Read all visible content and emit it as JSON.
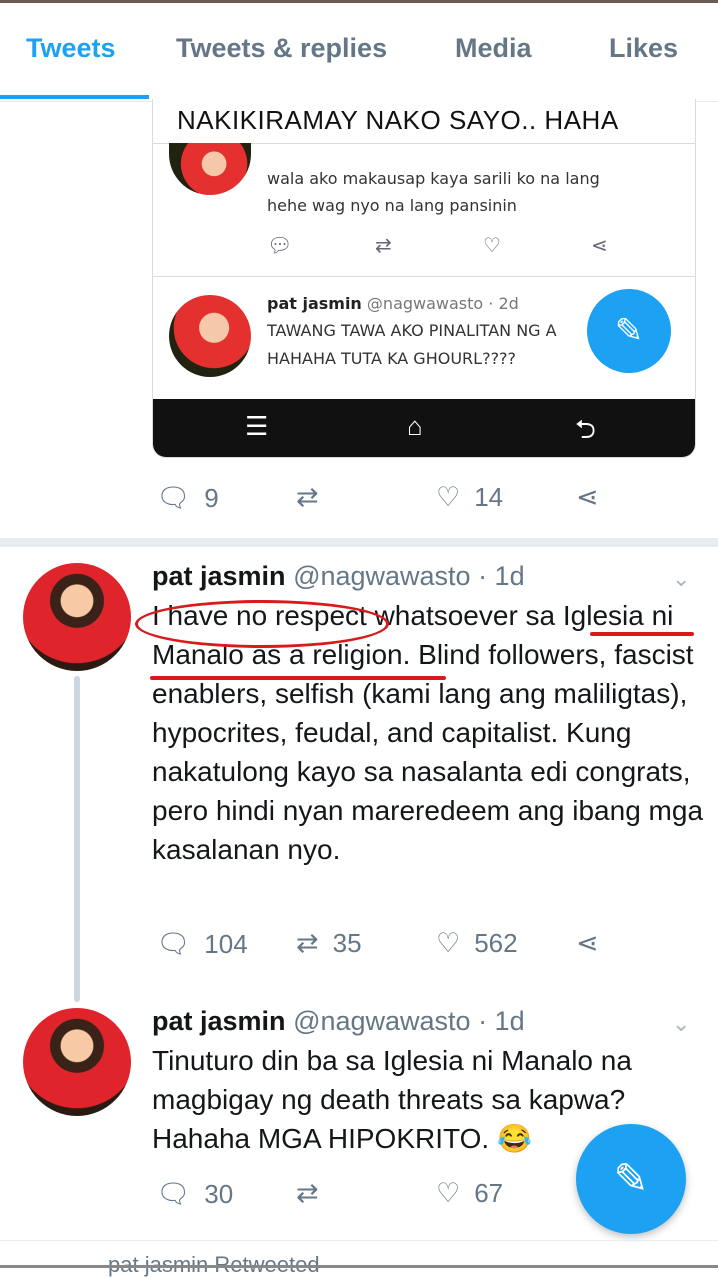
{
  "tabs": [
    {
      "label": "Tweets",
      "active": true
    },
    {
      "label": "Tweets & replies",
      "active": false
    },
    {
      "label": "Media",
      "active": false
    },
    {
      "label": "Likes",
      "active": false
    }
  ],
  "embedded_screenshot": {
    "caption": "NAKIKIRAMAY NAKO SAYO.. HAHA",
    "reply1_line1": "wala ako makausap kaya sarili ko na lang",
    "reply1_line2": "hehe wag nyo na lang pansinin",
    "reply2_name": "pat jasmin",
    "reply2_meta": "@nagwawasto · 2d",
    "reply2_line1": "TAWANG TAWA AKO PINALITAN NG A",
    "reply2_line2": "HAHAHA TUTA KA GHOURL????"
  },
  "tweets": [
    {
      "replies": "9",
      "retweets": "",
      "likes": "14"
    },
    {
      "name": "pat jasmin",
      "handle": "@nagwawasto · 1d",
      "text": "I have no respect whatsoever sa Iglesia ni Manalo as a religion. Blind followers, fascist enablers, selfish (kami lang ang maliligtas), hypocrites, feudal, and capitalist. Kung nakatulong kayo sa nasalanta edi congrats, pero hindi nyan mareredeem ang ibang mga kasalanan nyo.",
      "replies": "104",
      "retweets": "35",
      "likes": "562"
    },
    {
      "name": "pat jasmin",
      "handle": "@nagwawasto · 1d",
      "text": "Tinuturo din ba sa Iglesia ni Manalo na magbigay ng death threats sa kapwa? Hahaha MGA HIPOKRITO. 😂",
      "replies": "30",
      "retweets": "",
      "likes": "67"
    }
  ],
  "footer": {
    "retweeted_label": "pat jasmin Retweeted"
  },
  "colors": {
    "accent": "#1da1f2",
    "muted": "#657786",
    "annotation": "#d81a1a"
  }
}
